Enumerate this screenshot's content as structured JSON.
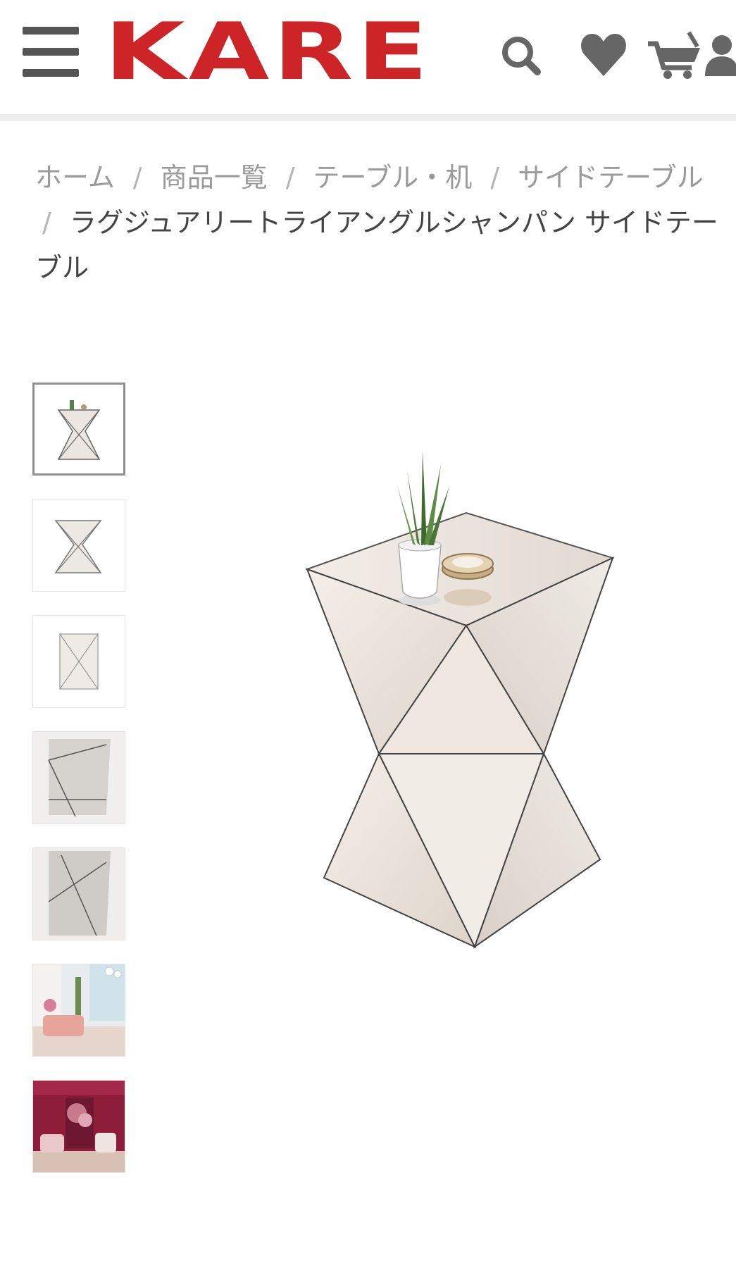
{
  "header": {
    "logo_text": "KARE",
    "brand_color": "#cc2427",
    "icons": [
      "menu-icon",
      "search-icon",
      "heart-icon",
      "cart-icon",
      "user-icon"
    ]
  },
  "breadcrumb": {
    "items": [
      "ホーム",
      "商品一覧",
      "テーブル・机",
      "サイドテーブル"
    ],
    "separator": "/",
    "current": "ラグジュアリートライアングルシャンパン サイドテーブル"
  },
  "gallery": {
    "thumbnails": [
      {
        "name": "thumb-front-with-plant",
        "selected": true
      },
      {
        "name": "thumb-top-view",
        "selected": false
      },
      {
        "name": "thumb-side-view",
        "selected": false
      },
      {
        "name": "thumb-detail-corner",
        "selected": false
      },
      {
        "name": "thumb-detail-edge",
        "selected": false
      },
      {
        "name": "thumb-room-scene-light",
        "selected": false
      },
      {
        "name": "thumb-room-scene-red",
        "selected": false
      }
    ]
  }
}
